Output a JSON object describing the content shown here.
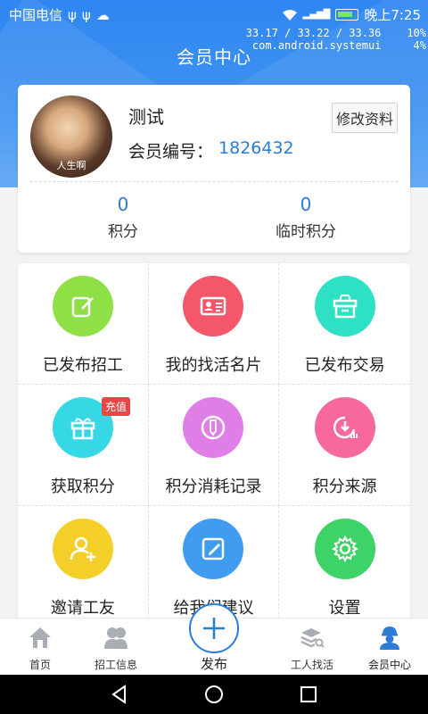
{
  "status_bar": {
    "carrier": "中国电信",
    "time": "晚上7:25",
    "debug_line1": "33.17 / 33.22 / 33.36",
    "debug_line2": "com.android.systemui",
    "debug_pct1": "10%",
    "debug_pct2": "4%"
  },
  "header": {
    "title": "会员中心"
  },
  "profile": {
    "avatar_caption": "人生啊",
    "name": "测试",
    "edit_label": "修改资料",
    "member_id_label": "会员编号：",
    "member_id_value": "1826432",
    "points_value": "0",
    "points_label": "积分",
    "temp_points_value": "0",
    "temp_points_label": "临时积分"
  },
  "menu": {
    "items": [
      {
        "label": "已发布招工",
        "icon": "edit-icon",
        "color": "#8fe047"
      },
      {
        "label": "我的找活名片",
        "icon": "id-card-icon",
        "color": "#f4576a"
      },
      {
        "label": "已发布交易",
        "icon": "box-icon",
        "color": "#2ee0c4"
      },
      {
        "label": "获取积分",
        "icon": "gift-icon",
        "color": "#37d8e6",
        "badge": "充值"
      },
      {
        "label": "积分消耗记录",
        "icon": "pencil-circle-icon",
        "color": "#e07ee8"
      },
      {
        "label": "积分来源",
        "icon": "download-chart-icon",
        "color": "#f7689c"
      },
      {
        "label": "邀请工友",
        "icon": "add-user-icon",
        "color": "#f4cf2a"
      },
      {
        "label": "给我们建议",
        "icon": "feedback-edit-icon",
        "color": "#3f9cf0"
      },
      {
        "label": "设置",
        "icon": "gear-icon",
        "color": "#3dd367"
      }
    ]
  },
  "bottom_nav": {
    "home": "首页",
    "hire_info": "招工信息",
    "publish": "发布",
    "find_work": "工人找活",
    "member": "会员中心"
  },
  "colors": {
    "primary": "#2c7bd8",
    "header": "#2f86f0"
  }
}
